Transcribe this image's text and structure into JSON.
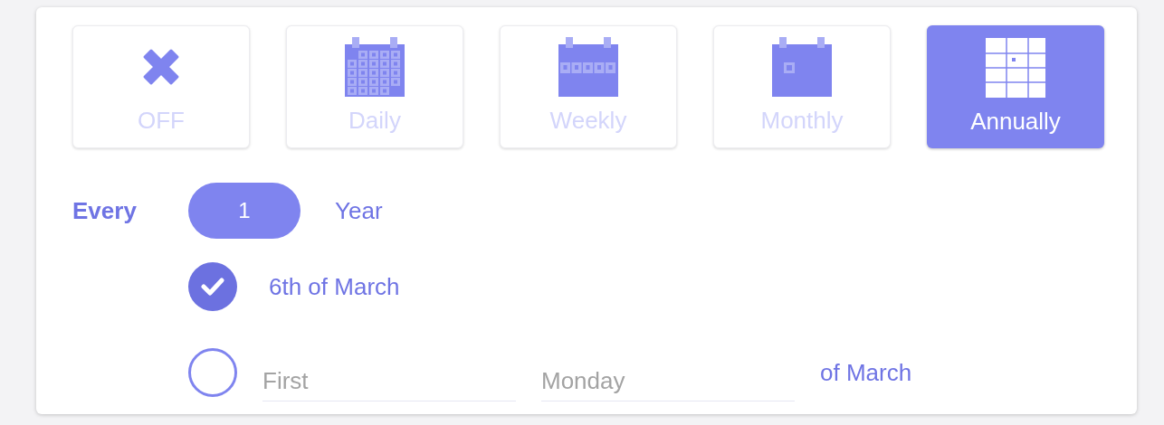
{
  "frequencies": [
    {
      "kind": "off",
      "label": "OFF",
      "selected": false
    },
    {
      "kind": "daily",
      "label": "Daily",
      "selected": false
    },
    {
      "kind": "weekly",
      "label": "Weekly",
      "selected": false
    },
    {
      "kind": "monthly",
      "label": "Monthly",
      "selected": false
    },
    {
      "kind": "annually",
      "label": "Annually",
      "selected": true
    }
  ],
  "interval": {
    "label": "Every",
    "value": "1",
    "unit": "Year"
  },
  "options": [
    {
      "kind": "date",
      "label": "6th of March",
      "selected": true
    },
    {
      "kind": "ordinal",
      "selected": false,
      "fields": [
        {
          "placeholder": "First"
        },
        {
          "placeholder": "Monday"
        }
      ],
      "suffix": "of March"
    }
  ]
}
